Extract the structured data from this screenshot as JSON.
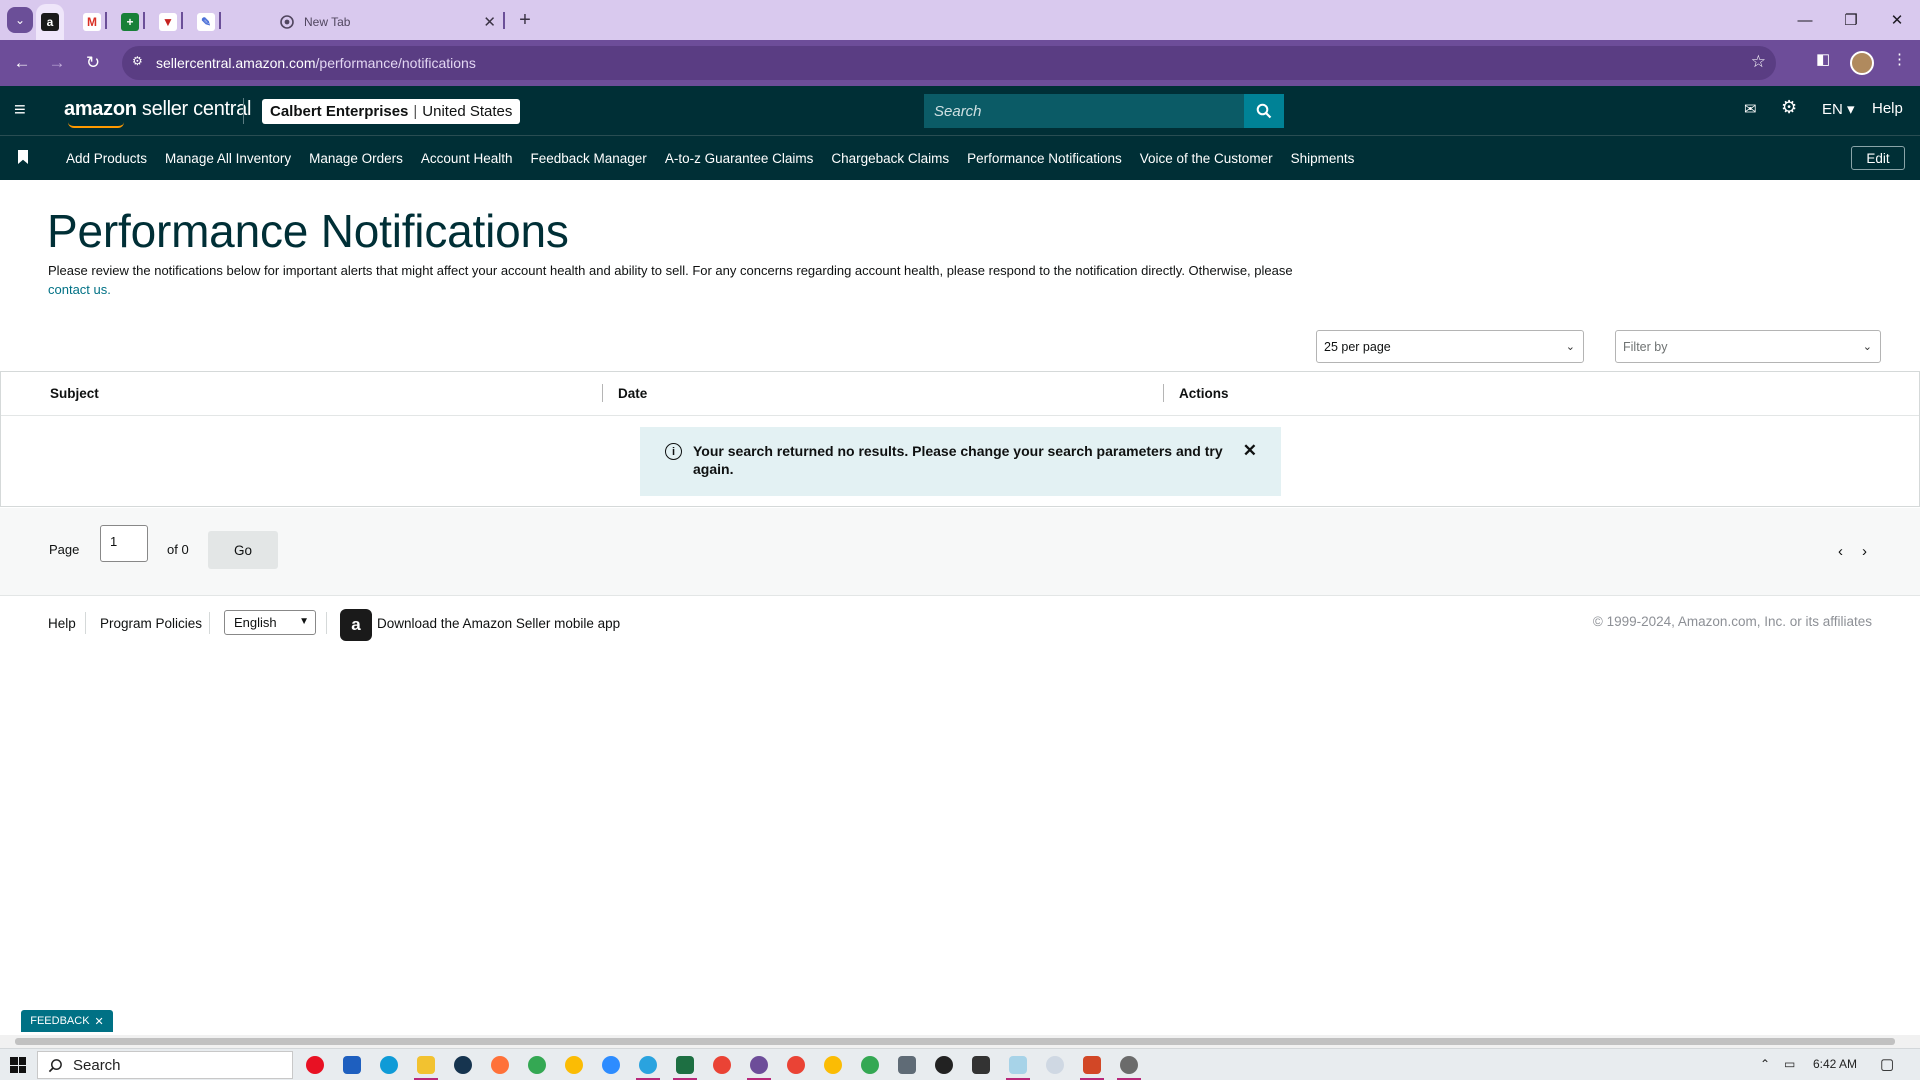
{
  "browser": {
    "tabs": [
      {
        "name": "amazon",
        "glyph": "a",
        "color": "#1a1a1a"
      },
      {
        "name": "gmail",
        "glyph": "M",
        "color": "#d93025"
      },
      {
        "name": "sheets",
        "glyph": "+",
        "color": "#188038"
      },
      {
        "name": "app-v",
        "glyph": "▼",
        "color": "#c5221f"
      },
      {
        "name": "app-pencil",
        "glyph": "✎",
        "color": "#4a6fd8"
      }
    ],
    "new_tab_title": "New Tab",
    "url_host": "sellercentral.amazon.com",
    "url_path": "/performance/notifications"
  },
  "header": {
    "logo_bold": "amazon",
    "logo_light": " seller central",
    "account_name": "Calbert Enterprises",
    "account_region": "United States",
    "search_placeholder": "Search",
    "language": "EN",
    "help": "Help"
  },
  "nav": {
    "links": [
      "Add Products",
      "Manage All Inventory",
      "Manage Orders",
      "Account Health",
      "Feedback Manager",
      "A-to-z Guarantee Claims",
      "Chargeback Claims",
      "Performance Notifications",
      "Voice of the Customer",
      "Shipments"
    ],
    "edit": "Edit"
  },
  "main": {
    "title": "Performance Notifications",
    "intro": "Please review the notifications below for important alerts that might affect your account health and ability to sell. For any concerns regarding account health, please respond to the notification directly. Otherwise, please ",
    "contact_link": "contact us.",
    "per_page": "25 per page",
    "filter_placeholder": "Filter by",
    "columns": [
      "Subject",
      "Date",
      "Actions"
    ],
    "empty_message": "Your search returned no results. Please change your search parameters and try again.",
    "pager": {
      "page_label": "Page",
      "current_page": "1",
      "of_label": "of 0",
      "go": "Go"
    }
  },
  "footer": {
    "help": "Help",
    "program_policies": "Program Policies",
    "language": "English",
    "app_text": "Download the Amazon Seller mobile app",
    "copyright": "© 1999-2024, Amazon.com, Inc. or its affiliates"
  },
  "feedback": "FEEDBACK",
  "taskbar": {
    "search": "Search",
    "time": "6:42 AM"
  },
  "colors": {
    "header_bg": "#002f36",
    "chrome_bg": "#6d4d99",
    "link": "#007185",
    "alert_bg": "#e3f1f3"
  }
}
